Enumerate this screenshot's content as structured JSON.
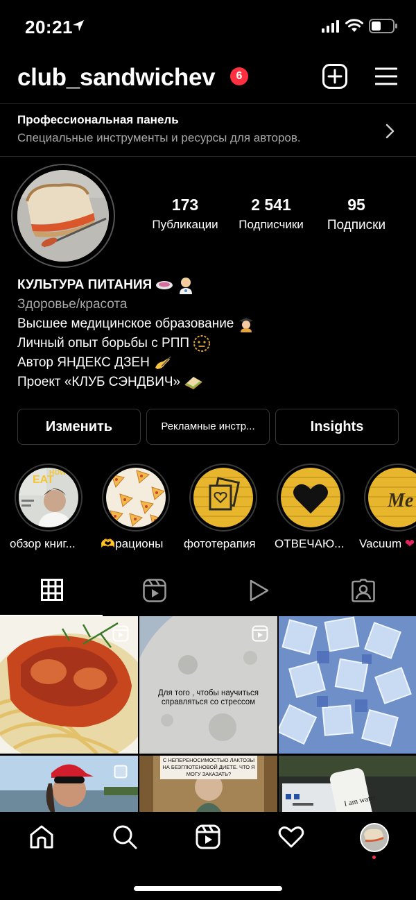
{
  "status_bar": {
    "time": "20:21"
  },
  "header": {
    "username": "club_sandwichev",
    "notification_count": "6"
  },
  "pro_panel": {
    "title": "Профессиональная панель",
    "subtitle": "Специальные инструменты и ресурсы для авторов."
  },
  "stats": [
    {
      "value": "173",
      "label": "Публикации"
    },
    {
      "value": "2 541",
      "label": "Подписчики"
    },
    {
      "value": "95",
      "label": "Подписки"
    }
  ],
  "bio": {
    "name": "КУЛЬТУРА ПИТАНИЯ",
    "category": "Здоровье/красота",
    "lines": [
      "Высшее медицинское образование",
      "Личный опыт борьбы с РПП",
      "Автор ЯНДЕКС ДЗЕН",
      "Проект «КЛУБ СЭНДВИЧ»"
    ]
  },
  "buttons": {
    "edit": "Изменить",
    "ads": "Рекламные инстр...",
    "insights": "Insights"
  },
  "highlights": [
    {
      "label": "обзор книг...",
      "icon": "magazine-cover"
    },
    {
      "label": "🫶рационы",
      "icon": "pizza-slices"
    },
    {
      "label": "фототерапия",
      "icon": "photos-icon"
    },
    {
      "label": "ОТВЕЧАЮ...",
      "icon": "heart-icon"
    },
    {
      "label": "Vacuum",
      "icon": "me-text"
    }
  ],
  "tabs": [
    {
      "name": "posts-grid",
      "icon": "grid-icon",
      "active": true
    },
    {
      "name": "reels",
      "icon": "reels-icon",
      "active": false
    },
    {
      "name": "videos",
      "icon": "play-icon",
      "active": false
    },
    {
      "name": "tagged",
      "icon": "tagged-icon",
      "active": false
    }
  ],
  "posts": {
    "moon_caption": "Для того , чтобы научиться справляться со стрессом",
    "meme_caption": "С НЕПЕРЕНОСИМОСТЬЮ ЛАКТОЗЫ НА БЕЗГЛЮТЕНОВОЙ ДИЕТЕ. ЧТО Я МОГУ ЗАКАЗАТЬ?",
    "water_label": "I am water."
  },
  "colors": {
    "background": "#000000",
    "secondary_text": "#a8a8a8",
    "badge": "#ff3040",
    "border": "#363636"
  }
}
